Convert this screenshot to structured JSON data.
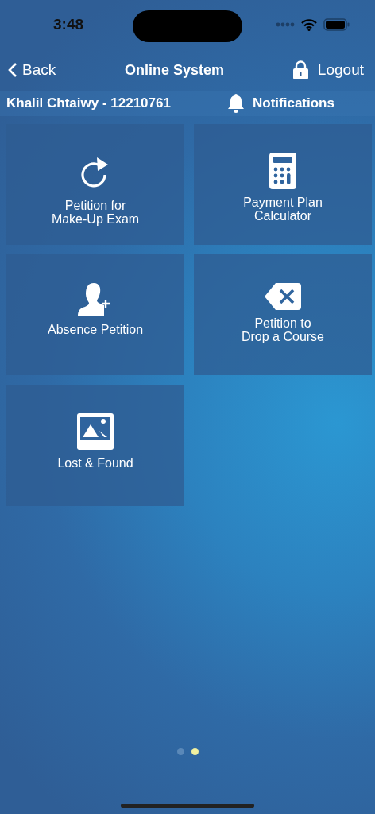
{
  "status_bar": {
    "time": "3:48"
  },
  "nav": {
    "back": "Back",
    "title": "Online System",
    "logout": "Logout"
  },
  "user_bar": {
    "user": "Khalil Chtaiwy - 12210761",
    "notifications": "Notifications"
  },
  "tiles": [
    {
      "label": "Petition for\nMake-Up Exam"
    },
    {
      "label": "Payment Plan\nCalculator"
    },
    {
      "label": "Absence Petition"
    },
    {
      "label": "Petition to\nDrop a Course"
    },
    {
      "label": "Lost & Found"
    }
  ],
  "pages": [
    {
      "selected": false
    },
    {
      "selected": true
    }
  ]
}
